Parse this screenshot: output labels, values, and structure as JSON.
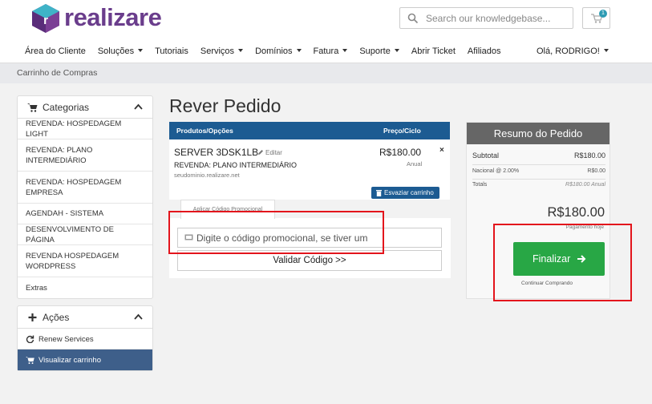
{
  "brand": {
    "name": "realizare",
    "logo_letter": "r"
  },
  "search": {
    "placeholder": "Search our knowledgebase..."
  },
  "cart": {
    "count": "1"
  },
  "nav": {
    "items": [
      "Área do Cliente",
      "Soluções",
      "Tutoriais",
      "Serviços",
      "Domínios",
      "Fatura",
      "Suporte",
      "Abrir Ticket",
      "Afiliados"
    ],
    "user": "Olá, RODRIGO!"
  },
  "breadcrumb": "Carrinho de Compras",
  "sidebar": {
    "categories_title": "Categorias",
    "categories": [
      "REVENDA: HOSPEDAGEM LIGHT",
      "REVENDA: PLANO INTERMEDIÁRIO",
      "REVENDA: HOSPEDAGEM EMPRESA",
      "AGENDAH - SISTEMA",
      "DESENVOLVIMENTO DE PÁGINA",
      "REVENDA HOSPEDAGEM WORDPRESS",
      "Extras"
    ],
    "actions_title": "Ações",
    "actions": [
      "Renew Services",
      "Visualizar carrinho"
    ]
  },
  "page_title": "Rever Pedido",
  "cart_table": {
    "col_products": "Produtos/Opções",
    "col_price": "Preço/Ciclo",
    "item": {
      "name": "SERVER 3DSK1LB",
      "edit": "Editar",
      "group": "REVENDA: PLANO INTERMEDIÁRIO",
      "domain": "seudominio.realizare.net",
      "price": "R$180.00",
      "cycle": "Anual",
      "remove": "×"
    },
    "empty_cart": "Esvaziar carrinho"
  },
  "promo": {
    "tab": "Aplicar Código Promocional",
    "placeholder": "Digite o código promocional, se tiver um",
    "validate": "Validar Código >>"
  },
  "summary": {
    "title": "Resumo do Pedido",
    "subtotal_label": "Subtotal",
    "subtotal": "R$180.00",
    "tax_label": "Nacional @ 2.00%",
    "tax": "R$0.00",
    "totals_label": "Totals",
    "totals": "R$180.00 Anual",
    "total": "R$180.00",
    "total_note": "Pagamento hoje",
    "checkout": "Finalizar",
    "continue": "Continuar Comprando"
  },
  "colors": {
    "brand_purple": "#6a3d8c",
    "header_blue": "#1c5b92",
    "checkout_green": "#28a745",
    "active_sidebar": "#3e5f8a",
    "annotation_red": "#e3151c"
  }
}
